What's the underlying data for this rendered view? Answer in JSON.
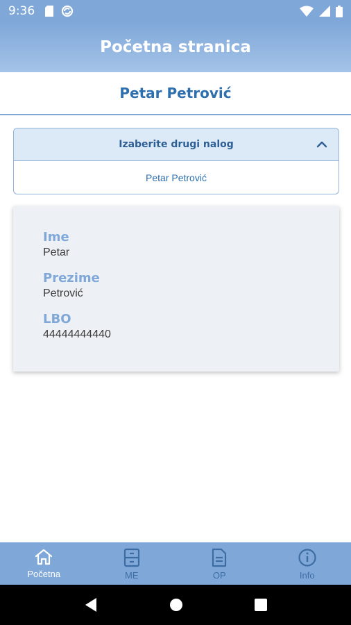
{
  "status_bar": {
    "time": "9:36",
    "left_icons": [
      "sd-card-icon",
      "sync-icon"
    ],
    "right_icons": [
      "wifi-icon",
      "signal-icon",
      "battery-icon"
    ]
  },
  "app_bar": {
    "title": "Početna stranica"
  },
  "user_header": {
    "name": "Petar Petrović"
  },
  "account_dropdown": {
    "title": "Izaberite drugi nalog",
    "expanded": true,
    "options": [
      "Petar Petrović"
    ]
  },
  "info_card": {
    "fields": [
      {
        "label": "Ime",
        "value": "Petar"
      },
      {
        "label": "Prezime",
        "value": "Petrović"
      },
      {
        "label": "LBO",
        "value": "44444444440"
      }
    ]
  },
  "bottom_nav": {
    "items": [
      {
        "label": "Početna",
        "icon": "home-icon",
        "active": true
      },
      {
        "label": "ME",
        "icon": "cabinet-icon",
        "active": false
      },
      {
        "label": "OP",
        "icon": "document-icon",
        "active": false
      },
      {
        "label": "Info",
        "icon": "info-icon",
        "active": false
      }
    ]
  },
  "colors": {
    "primary": "#7fa8d9",
    "accent_text": "#2e6fae",
    "card_bg": "#edf1f5",
    "dropdown_header_bg": "#dce9f7"
  }
}
